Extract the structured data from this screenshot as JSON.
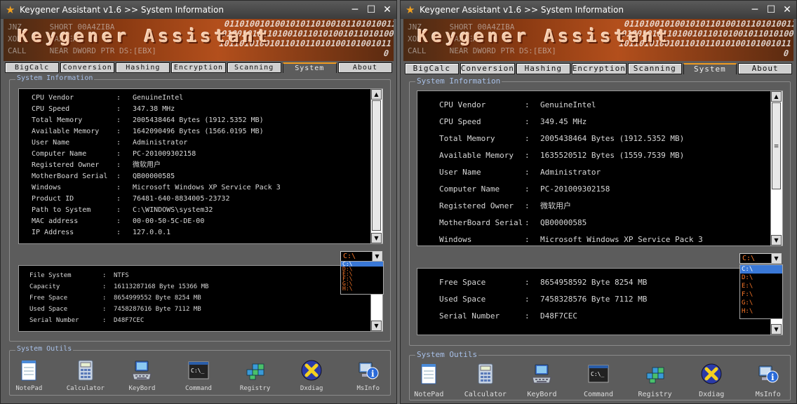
{
  "windows": [
    {
      "title": "Keygener Assistant v1.6  >>  System Information",
      "banner": {
        "logo": "Keygener Assistant",
        "asm_lines": [
          "JNZ      SHORT 00A4ZIBA",
          "XOR      EAX,EAX",
          "CALL     NEAR DWORD PTR DS:[EBX]"
        ],
        "binary": "0110100101001010110100101101010011010010101101001011010100101101010010110101001011010110101001010010110"
      },
      "tabs": [
        "BigCalc",
        "Conversion",
        "Hashing",
        "Encryption",
        "Scanning",
        "System",
        "About"
      ],
      "active_tab": 5,
      "group_info_label": "System Information",
      "sysinfo": [
        {
          "key": "CPU Vendor",
          "sep": ":",
          "value": "GenuineIntel"
        },
        {
          "key": "CPU Speed",
          "sep": ":",
          "value": "347.38 MHz"
        },
        {
          "key": "Total Memory",
          "sep": ":",
          "value": "2005438464 Bytes    (1912.5352 MB)"
        },
        {
          "key": "Available Memory",
          "sep": ":",
          "value": "1642090496 Bytes    (1566.0195 MB)"
        },
        {
          "key": "User Name",
          "sep": ":",
          "value": "Administrator"
        },
        {
          "key": "Computer Name",
          "sep": ":",
          "value": "PC-201009302158"
        },
        {
          "key": "Registered Owner",
          "sep": ":",
          "value": "微软用户"
        },
        {
          "key": "MotherBoard Serial",
          "sep": ":",
          "value": "QB00000585"
        },
        {
          "key": "Windows",
          "sep": ":",
          "value": "Microsoft Windows XP  Service Pack 3"
        },
        {
          "key": "Product ID",
          "sep": ":",
          "value": "76481-640-8834005-23732"
        },
        {
          "key": "Path to System",
          "sep": ":",
          "value": "C:\\WINDOWS\\system32"
        },
        {
          "key": "MAC address",
          "sep": ":",
          "value": "00-00-50-5C-DE-00"
        },
        {
          "key": "IP Address",
          "sep": ":",
          "value": "127.0.0.1"
        }
      ],
      "drive": {
        "selected": "C:\\",
        "options": [
          "C:\\",
          "D:\\",
          "E:\\",
          "F:\\",
          "G:\\",
          "H:\\"
        ],
        "selected_index": 0
      },
      "diskinfo": [
        {
          "key": "File System",
          "sep": ":",
          "value": "NTFS"
        },
        {
          "key": "Capacity",
          "sep": ":",
          "value": "16113287168 Byte     15366 MB"
        },
        {
          "key": "Free Space",
          "sep": ":",
          "value": "8654999552 Byte     8254 MB"
        },
        {
          "key": "Used Space",
          "sep": ":",
          "value": "7458287616 Byte     7112 MB"
        },
        {
          "key": "Serial Number",
          "sep": ":",
          "value": "D48F7CEC"
        }
      ],
      "group_tools_label": "System Outils",
      "tools": [
        {
          "label": "NotePad",
          "icon": "notepad-icon"
        },
        {
          "label": "Calculator",
          "icon": "calculator-icon"
        },
        {
          "label": "KeyBord",
          "icon": "keyboard-icon"
        },
        {
          "label": "Command",
          "icon": "command-icon"
        },
        {
          "label": "Registry",
          "icon": "registry-icon"
        },
        {
          "label": "Dxdiag",
          "icon": "dxdiag-icon"
        },
        {
          "label": "MsInfo",
          "icon": "msinfo-icon"
        }
      ]
    },
    {
      "title": "Keygener Assistant v1.6  >>  System Information",
      "banner": {
        "logo": "Keygener Assistant",
        "asm_lines": [
          "JNZ      SHORT 00A4ZIBA",
          "XOR      EAX,EAX",
          "CALL     NEAR DWORD PTR DS:[EBX]"
        ],
        "binary": "0110100101001010110100101101010011010010101101001011010100101101010010110101001011010110101001010010110"
      },
      "tabs": [
        "BigCalc",
        "Conversion",
        "Hashing",
        "Encryption",
        "Scanning",
        "System",
        "About"
      ],
      "active_tab": 5,
      "group_info_label": "System Information",
      "sysinfo": [
        {
          "key": "CPU Vendor",
          "sep": ":",
          "value": "GenuineIntel"
        },
        {
          "key": "CPU Speed",
          "sep": ":",
          "value": "349.45 MHz"
        },
        {
          "key": "Total Memory",
          "sep": ":",
          "value": "2005438464 Bytes    (1912.5352 MB)"
        },
        {
          "key": "Available Memory",
          "sep": ":",
          "value": "1635520512 Bytes    (1559.7539 MB)"
        },
        {
          "key": "User Name",
          "sep": ":",
          "value": "Administrator"
        },
        {
          "key": "Computer Name",
          "sep": ":",
          "value": "PC-201009302158"
        },
        {
          "key": "Registered Owner",
          "sep": ":",
          "value": "微软用户"
        },
        {
          "key": "MotherBoard Serial",
          "sep": ":",
          "value": "QB00000585"
        },
        {
          "key": "Windows",
          "sep": ":",
          "value": "Microsoft Windows XP  Service Pack 3"
        }
      ],
      "drive": {
        "selected": "C:\\",
        "options": [
          "C:\\",
          "D:\\",
          "E:\\",
          "F:\\",
          "G:\\",
          "H:\\"
        ],
        "selected_index": 0
      },
      "diskinfo": [
        {
          "key": "Free Space",
          "sep": ":",
          "value": "8654958592 Byte     8254 MB"
        },
        {
          "key": "Used Space",
          "sep": ":",
          "value": "7458328576 Byte     7112 MB"
        },
        {
          "key": "Serial Number",
          "sep": ":",
          "value": "D48F7CEC"
        }
      ],
      "group_tools_label": "System Outils",
      "tools": [
        {
          "label": "NotePad",
          "icon": "notepad-icon"
        },
        {
          "label": "Calculator",
          "icon": "calculator-icon"
        },
        {
          "label": "KeyBord",
          "icon": "keyboard-icon"
        },
        {
          "label": "Command",
          "icon": "command-icon"
        },
        {
          "label": "Registry",
          "icon": "registry-icon"
        },
        {
          "label": "Dxdiag",
          "icon": "dxdiag-icon"
        },
        {
          "label": "MsInfo",
          "icon": "msinfo-icon"
        }
      ]
    }
  ],
  "colors": {
    "accent_tab": "#f09a20",
    "group_label": "#a8c0e8",
    "drive_text": "#ff7a2a",
    "selection": "#3a78d6"
  }
}
